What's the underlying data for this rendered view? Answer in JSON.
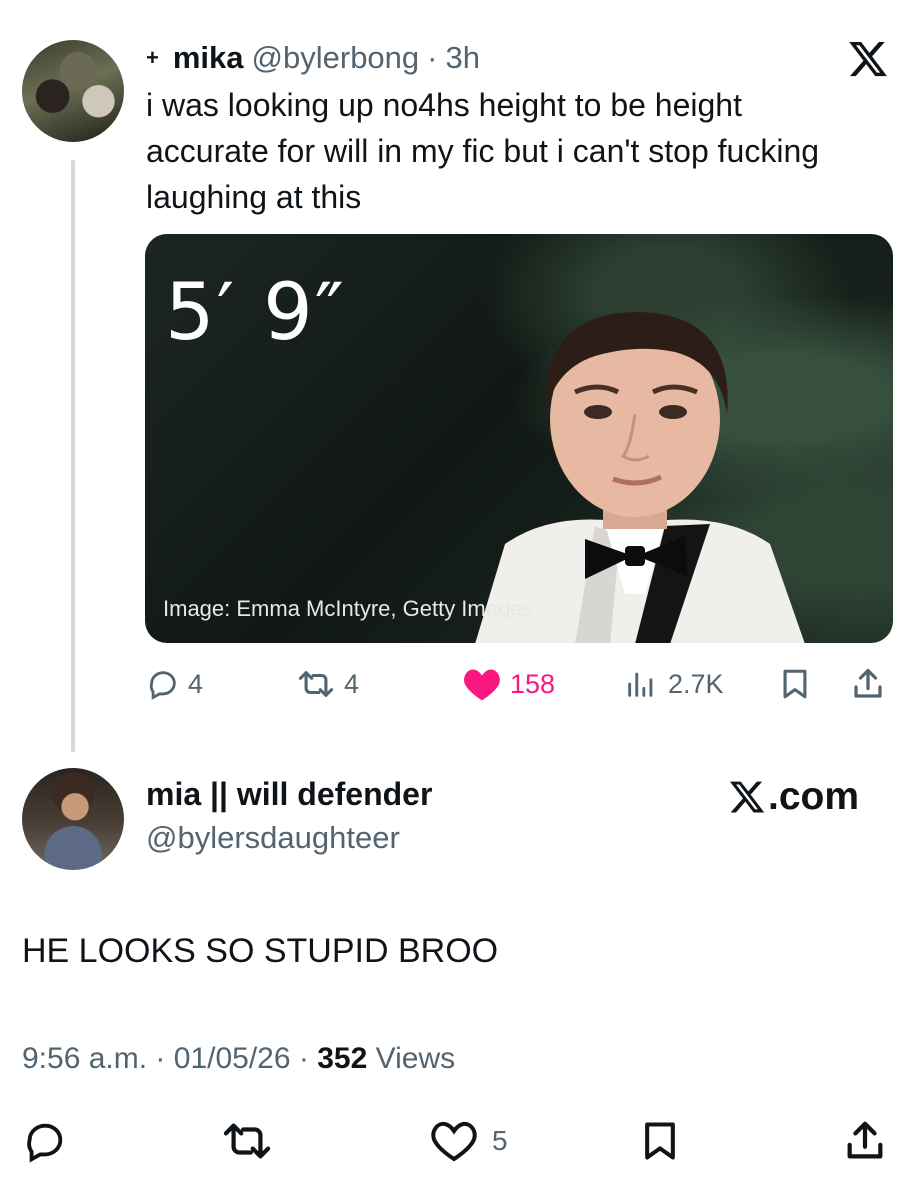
{
  "quoted": {
    "badge": "+",
    "name": "mika",
    "handle": "@bylerbong",
    "separator": "·",
    "time": "3h",
    "text": "i was looking up no4hs height to be height accurate for will in my fic but i can't stop fucking laughing at this",
    "media": {
      "overlay_text": "5′ 9″",
      "caption": "Image: Emma McIntyre, Getty Images"
    },
    "actions": {
      "replies": "4",
      "reposts": "4",
      "likes": "158",
      "views": "2.7K"
    }
  },
  "reply": {
    "name": "mia || will defender",
    "handle": "@bylersdaughteer",
    "brand": ".com",
    "text": "HE LOOKS SO STUPID BROO",
    "time": "9:56 a.m.",
    "date": "01/05/26",
    "views_count": "352",
    "views_label": "Views",
    "sep": "·",
    "actions": {
      "likes": "5"
    }
  },
  "colors": {
    "text": "#0f1419",
    "secondary": "#536471",
    "like": "#f91880",
    "thread_line": "#cfd9de"
  },
  "icons": [
    "x-logo-icon",
    "reply-icon",
    "repost-icon",
    "heart-icon",
    "views-icon",
    "bookmark-icon",
    "share-icon"
  ]
}
